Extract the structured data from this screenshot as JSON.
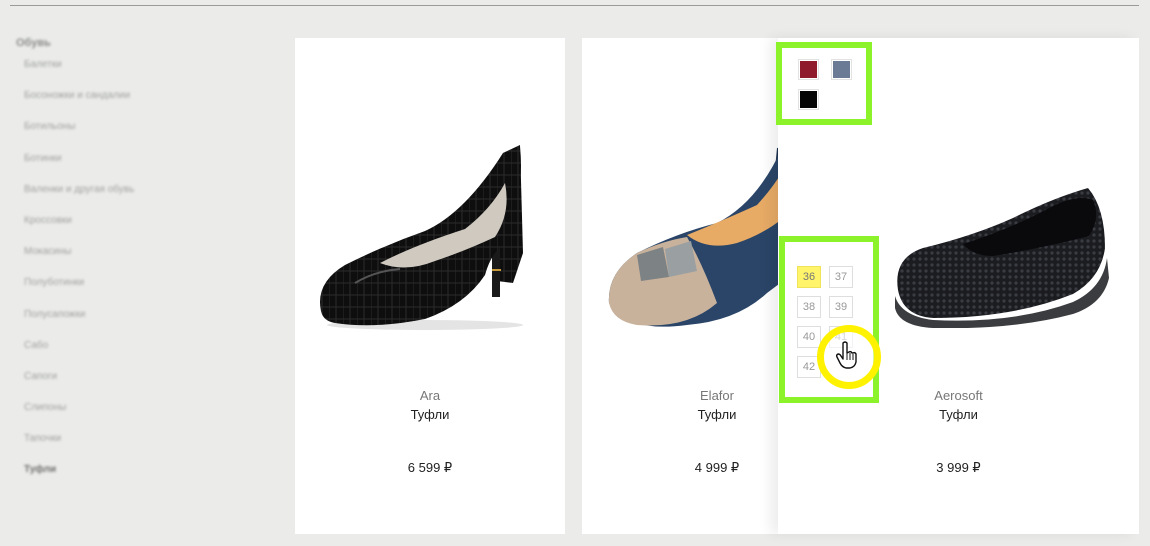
{
  "sidebar": {
    "heading": "Обувь",
    "items": [
      {
        "label": "Балетки"
      },
      {
        "label": "Босоножки и сандалии"
      },
      {
        "label": "Ботильоны"
      },
      {
        "label": "Ботинки"
      },
      {
        "label": "Валенки и другая обувь"
      },
      {
        "label": "Кроссовки"
      },
      {
        "label": "Мокасины"
      },
      {
        "label": "Полуботинки"
      },
      {
        "label": "Полусапожки"
      },
      {
        "label": "Сабо"
      },
      {
        "label": "Сапоги"
      },
      {
        "label": "Слипоны"
      },
      {
        "label": "Тапочки"
      },
      {
        "label": "Туфли"
      }
    ]
  },
  "products": [
    {
      "brand": "Ara",
      "type": "Туфли",
      "price": "6 599 ₽"
    },
    {
      "brand": "Elafor",
      "type": "Туфли",
      "price": "4 999 ₽"
    },
    {
      "brand": "Aerosoft",
      "type": "Туфли",
      "price": "3 999 ₽"
    }
  ],
  "colors": [
    {
      "name": "burgundy-swatch",
      "hex": "#8f1a2b"
    },
    {
      "name": "slate-blue-swatch",
      "hex": "#6b7b96"
    },
    {
      "name": "black-swatch",
      "hex": "#050505"
    }
  ],
  "sizes": [
    {
      "label": "36",
      "selected": true
    },
    {
      "label": "37"
    },
    {
      "label": "38"
    },
    {
      "label": "39"
    },
    {
      "label": "40"
    },
    {
      "label": "41"
    },
    {
      "label": "42"
    }
  ]
}
